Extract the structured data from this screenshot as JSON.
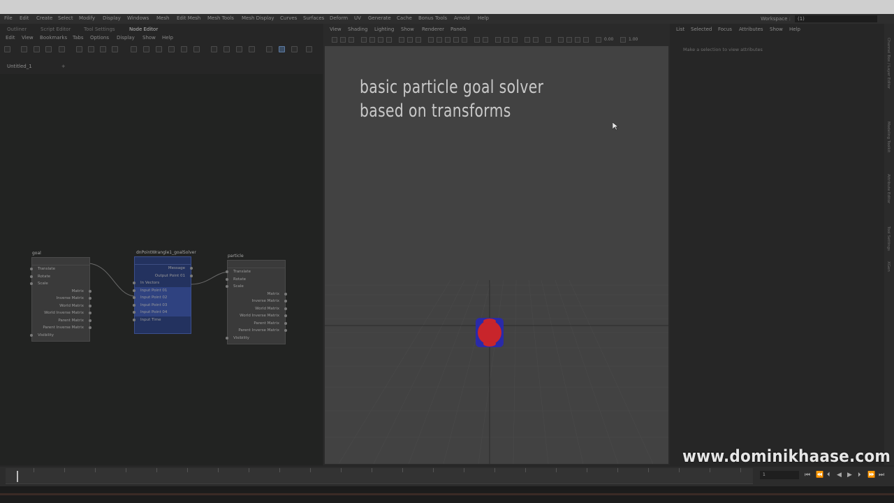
{
  "menubar": {
    "items": [
      "File",
      "Edit",
      "Create",
      "Select",
      "Modify",
      "Display",
      "Windows",
      "Mesh",
      "Edit Mesh",
      "Mesh Tools",
      "Mesh Display",
      "Curves",
      "Surfaces",
      "Deform",
      "UV",
      "Generate",
      "Cache",
      "Bonus Tools",
      "Arnold",
      "Help"
    ],
    "workspace_label": "Workspace :",
    "workspace_value": "(1)"
  },
  "node_editor": {
    "tabs": [
      "Outliner",
      "Script Editor",
      "Tool Settings",
      "Node Editor"
    ],
    "active_tab": "Node Editor",
    "menu": [
      "Edit",
      "View",
      "Bookmarks",
      "Tabs",
      "Options",
      "Display",
      "Show",
      "Help"
    ],
    "sheet_tab": "Untitled_1",
    "add_tab": "+",
    "nodes": {
      "goal": {
        "title": "goal",
        "attrs_left": [
          "Translate",
          "Rotate",
          "Scale"
        ],
        "attrs_right": [
          "Matrix",
          "Inverse Matrix",
          "World Matrix",
          "World Inverse Matrix",
          "Parent Matrix",
          "Parent Inverse Matrix"
        ],
        "last": "Visibility"
      },
      "solver": {
        "title": "dnPointWrangle1_goalSolver",
        "attrs_right": [
          "Message",
          "Output Point 01"
        ],
        "attrs_left": [
          "In Vectors",
          "Input Point 01",
          "Input Point 02",
          "Input Point 03",
          "Input Point 04",
          "Input Time"
        ]
      },
      "particle": {
        "title": "particle",
        "attrs_left": [
          "Translate",
          "Rotate",
          "Scale"
        ],
        "attrs_right": [
          "Matrix",
          "Inverse Matrix",
          "World Matrix",
          "World Inverse Matrix",
          "Parent Matrix",
          "Parent Inverse Matrix"
        ],
        "last": "Visibility"
      }
    }
  },
  "viewport": {
    "menu": [
      "View",
      "Shading",
      "Lighting",
      "Show",
      "Renderer",
      "Panels"
    ],
    "field_value": "0.00",
    "field_value2": "1.00",
    "caption_line1": "basic particle goal solver",
    "caption_line2": "based on transforms"
  },
  "attribute_editor": {
    "menu": [
      "List",
      "Selected",
      "Focus",
      "Attributes",
      "Show",
      "Help"
    ],
    "message": "Make a selection to view attributes"
  },
  "side_tabs": [
    "Channel Box / Layer Editor",
    "Modeling Toolkit",
    "Attribute Editor",
    "Tool Settings",
    "XGen"
  ],
  "timeline": {
    "current_frame": "1"
  },
  "watermark": "www.dominikhaase.com",
  "colors": {
    "solver_node": "#23325f",
    "particle_red": "#c8252b",
    "particle_blue": "#2a2aa8"
  }
}
